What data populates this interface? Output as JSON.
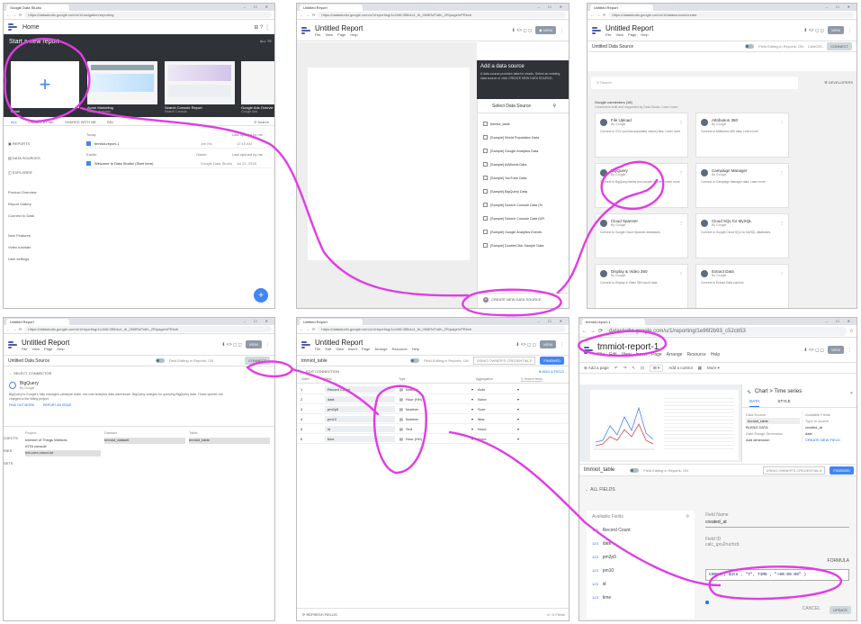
{
  "panel1": {
    "tab": "Google Data Studio",
    "url": "https://datastudio.google.com/u/1/navigation/reporting",
    "home": "Home",
    "start_label": "Start a new report",
    "all_label": "ALL TE",
    "templates": [
      {
        "title": "Blank",
        "sub": ""
      },
      {
        "title": "Acme Marketing",
        "sub": "Google Analytics"
      },
      {
        "title": "Search Console Report",
        "sub": "Search Console"
      },
      {
        "title": "Google Ads Overvie",
        "sub": "Google Ads"
      }
    ],
    "tabs": [
      "ALL",
      "OWNED BY ME",
      "SHARED WITH ME",
      "BIN"
    ],
    "search": "Search",
    "nav": [
      "REPORTS",
      "DATA SOURCES",
      "EXPLORER"
    ],
    "nav2": [
      "Product Overview",
      "Report Gallery",
      "Connect to Data"
    ],
    "nav3": [
      "New Features",
      "Video tutorials",
      "User settings"
    ],
    "h_today": "Today",
    "h_earlier": "Earlier",
    "h_owner": "Owner",
    "h_last": "Last opened by me",
    "files": [
      {
        "name": "tmmiot-report-1",
        "owner": "Jim Ha",
        "time": "12:15 AM"
      },
      {
        "name": "Welcome to Data Studio! (Start here)",
        "owner": "Google Data Studio",
        "time": "Jul 22, 2018"
      }
    ]
  },
  "panel2": {
    "tab": "Untitled Report",
    "url": "https://datastudio.google.com/u/1/reporting/1c2e6f-0f5b4c1_lb_2M6RcPu6h_2R/page/nPRbvb",
    "title": "Untitled Report",
    "menu": [
      "File",
      "View",
      "Page",
      "Help"
    ],
    "view": "VIEW",
    "add_title": "Add a data source",
    "add_desc": "A data source provides data for charts. Select an existing data source or click CREATE NEW DATA SOURCE.",
    "select_label": "Select Data Source",
    "sources": [
      "tmmiot_table",
      "[Sample] World Population Data",
      "[Sample] Google Analytics Data",
      "[Sample] AdWords Data",
      "[Sample] YouTube Data",
      "[Sample] BigQuery Data",
      "[Sample] Search Console Data (Si",
      "[Sample] Search Console Data (UR",
      "[Sample] Google Analytics Events",
      "[Sample] DoubleClick Sample Data"
    ],
    "create": "CREATE NEW DATA SOURCE"
  },
  "panel3": {
    "tab": "Untitled Report",
    "url": "https://datastudio.google.com/u/1/datasources/create",
    "title": "Untitled Data Source",
    "toggle": "Field Editing in Reports: ON",
    "cancel": "CANCEL",
    "connect": "CONNECT",
    "search": "Search",
    "developers": "DEVELOPERS",
    "connectors_header": "Google connectors (18)",
    "connectors_sub": "Connectors built and supported by Data Studio. Learn more",
    "connectors": [
      {
        "name": "File Upload",
        "by": "By Google",
        "desc": "Connect to CSV (comma-separated values) files. Learn more"
      },
      {
        "name": "Attribution 360",
        "by": "By Google",
        "desc": "Connect to Attribution 360 data. Learn more"
      },
      {
        "name": "BigQuery",
        "by": "By Google",
        "desc": "Connect to BigQuery tables and custom queries. Learn more"
      },
      {
        "name": "Campaign Manager",
        "by": "By Google",
        "desc": "Connect to Campaign Manager data. Learn more"
      },
      {
        "name": "Cloud Spanner",
        "by": "By Google",
        "desc": "Connect to Google Cloud Spanner databases."
      },
      {
        "name": "Cloud SQL for MySQL",
        "by": "By Google",
        "desc": "Connect to Google Cloud SQL for MySQL databases."
      },
      {
        "name": "Display & Video 360",
        "by": "By Google",
        "desc": "Connect to Display & Video 360 report data."
      },
      {
        "name": "Extract Data",
        "by": "By Google",
        "desc": "Connect to Extract Data sources."
      }
    ]
  },
  "panel4": {
    "tab": "Untitled Report",
    "url": "https://datastudio.google.com/u/1/reporting/1c2e6f-0f5b4c1_lb_2M6RcPu6h_2R/page/nPRbvb",
    "title": "Untitled Report",
    "menu": [
      "File",
      "View",
      "Page",
      "Help"
    ],
    "view": "VIEW",
    "ds_title": "Untitled Data Source",
    "toggle": "Field Editing in Reports: ON",
    "connect": "CONNECT",
    "back": "SELECT CONNECTOR",
    "bq_name": "BigQuery",
    "bq_by": "By Google",
    "bq_desc": "BigQuery is Google's fully managed, petabyte scale, low cost analytics data warehouse. BigQuery charges for querying BigQuery data. Those queries are charged to the billing project.",
    "learn": "FIND OUT MORE",
    "report": "REPORT AN ISSUE",
    "left_items": [
      "OJECTS",
      "RIES",
      "SETS"
    ],
    "col_project": "Project",
    "col_dataset": "Dataset",
    "col_table": "Table",
    "projects": [
      "Internet of Things Werkies",
      "IOTA console",
      "bot-core-cloud-iot"
    ],
    "dataset": "tmmiot_dataset",
    "table": "tmmiot_table"
  },
  "panel5": {
    "tab": "Untitled Report",
    "url": "https://datastudio.google.com/u/1/reporting/1c2e6f-0f5b4c1_lb_2M6RcPu6h_2R/page/nPRbvb",
    "title": "Untitled Report",
    "menu": [
      "File",
      "Edit",
      "View",
      "Insert",
      "Page",
      "Arrange",
      "Resource",
      "Help"
    ],
    "view": "VIEW",
    "ds_title": "tmmiot_table",
    "toggle": "Field Editing in Reports: ON",
    "creds": "USING OWNER'S CREDENTIALS",
    "finished": "FINISHED",
    "edit_conn": "EDIT CONNECTION",
    "add_field": "ADD A FIELD",
    "search": "Search fields",
    "headers": [
      "Index",
      "Field",
      "Type",
      "Aggregation"
    ],
    "fields": [
      {
        "idx": "1",
        "name": "Record Count",
        "type": "Number",
        "agg": "Auto"
      },
      {
        "idx": "2",
        "name": "date",
        "type": "Hour (HH)",
        "agg": "None"
      },
      {
        "idx": "3",
        "name": "pm2p5",
        "type": "Number",
        "agg": "Sum"
      },
      {
        "idx": "4",
        "name": "pm10",
        "type": "Number",
        "agg": "Max"
      },
      {
        "idx": "5",
        "name": "id",
        "type": "Text",
        "agg": "None"
      },
      {
        "idx": "6",
        "name": "time",
        "type": "Hour (HH)",
        "agg": "None"
      }
    ],
    "refresh": "REFRESH FIELDS",
    "count": "6 / 6 Fields"
  },
  "panel6": {
    "tab": "tmmiot-report-1",
    "url": "datastudio.google.com/u/1/reporting/1e96f2b93_c52cb53",
    "title": "tmmiot-report-1",
    "menu": [
      "File",
      "Edit",
      "View",
      "Insert",
      "Page",
      "Arrange",
      "Resource",
      "Help"
    ],
    "view": "VIEW",
    "add_page": "Add a page",
    "add_control": "Add a control",
    "more": "More",
    "chart_type": "Chart > Time series",
    "data_tab": "DATA",
    "style_tab": "STYLE",
    "data_source": "Data Source",
    "ds_name": "tmmiot_table",
    "blend": "BLEND DATA",
    "avail": "Available Fields",
    "search": "Type to search",
    "avail_items": [
      "created_at",
      "date"
    ],
    "date_range": "Date Range Dimension",
    "add_dim": "Add dimension",
    "create_field": "CREATE NEW FIELD",
    "ds_title": "tmmiot_table",
    "toggle": "Field Editing in Reports: ON",
    "creds": "USING OWNER'S CREDENTIALS",
    "finished": "FINISHED",
    "all_fields": "ALL FIELDS",
    "avail_label": "Available Fields",
    "left_fields": [
      "Record Count",
      "date",
      "pm2p5",
      "pm10",
      "id",
      "time"
    ],
    "field_name_label": "Field Name",
    "field_name": "created_at",
    "field_id_label": "Field ID",
    "field_id": "calc_qxu2ruchzb",
    "formula_label": "FORMULA",
    "formula": "CONCAT( date , \"T\", TIME , \"+00:00:00\" )",
    "cancel": "CANCEL",
    "update": "UPDATE"
  }
}
